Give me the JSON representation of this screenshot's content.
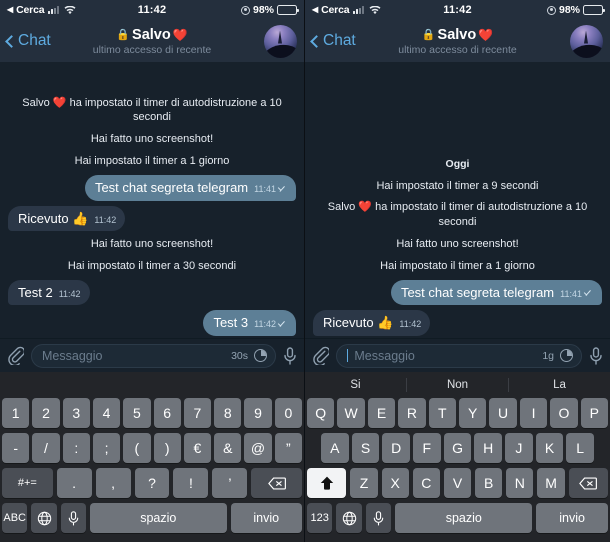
{
  "screens": [
    {
      "id": "left",
      "status_bar": {
        "back_arrow": "◀",
        "carrier_label": "Cerca",
        "time": "11:42",
        "battery_percent": "98%"
      },
      "header": {
        "back_label": "Chat",
        "lock_icon": "lock-icon",
        "title": "Salvo",
        "title_emoji": "❤️",
        "subtitle": "ultimo accesso di recente",
        "avatar": "contact-avatar"
      },
      "messages": [
        {
          "kind": "service",
          "text": "Salvo ❤️ ha impostato il timer di autodistruzione a 10 secondi"
        },
        {
          "kind": "service",
          "text": "Hai fatto uno screenshot!"
        },
        {
          "kind": "service",
          "text": "Hai impostato il timer a 1 giorno"
        },
        {
          "kind": "out",
          "text": "Test chat segreta telegram",
          "time": "11:41",
          "read": true
        },
        {
          "kind": "in",
          "text": "Ricevuto 👍",
          "time": "11:42",
          "read": false
        },
        {
          "kind": "service",
          "text": "Hai fatto uno screenshot!"
        },
        {
          "kind": "service",
          "text": "Hai impostato il timer a 30 secondi"
        },
        {
          "kind": "in",
          "text": "Test 2",
          "time": "11:42",
          "read": false
        },
        {
          "kind": "out",
          "text": "Test 3",
          "time": "11:42",
          "read": true
        }
      ],
      "input_bar": {
        "attach_icon": "paperclip-icon",
        "placeholder": "Messaggio",
        "show_caret": false,
        "timer_value": "30s",
        "timer_icon": "self-destruct-timer-icon",
        "mic_icon": "microphone-icon"
      },
      "keyboard": {
        "layout": "numeric-symbols",
        "predictions": [],
        "rows": [
          [
            "1",
            "2",
            "3",
            "4",
            "5",
            "6",
            "7",
            "8",
            "9",
            "0"
          ],
          [
            "-",
            "/",
            ":",
            ";",
            "(",
            ")",
            "€",
            "&",
            "@",
            "”"
          ],
          [
            "#+=",
            ".",
            ",",
            "?",
            "!",
            "’",
            "backspace-icon"
          ],
          [
            "ABC",
            "globe-icon",
            "microphone-icon",
            "spazio",
            "invio"
          ]
        ],
        "shift_active": false
      }
    },
    {
      "id": "right",
      "status_bar": {
        "back_arrow": "◀",
        "carrier_label": "Cerca",
        "time": "11:42",
        "battery_percent": "98%"
      },
      "header": {
        "back_label": "Chat",
        "lock_icon": "lock-icon",
        "title": "Salvo",
        "title_emoji": "❤️",
        "subtitle": "ultimo accesso di recente",
        "avatar": "contact-avatar"
      },
      "messages": [
        {
          "kind": "date",
          "text": "Oggi"
        },
        {
          "kind": "service",
          "text": "Hai impostato il timer a 9 secondi"
        },
        {
          "kind": "service",
          "text": "Salvo ❤️ ha impostato il timer di autodistruzione a 10 secondi"
        },
        {
          "kind": "service",
          "text": "Hai fatto uno screenshot!"
        },
        {
          "kind": "service",
          "text": "Hai impostato il timer a 1 giorno"
        },
        {
          "kind": "out",
          "text": "Test chat segreta telegram",
          "time": "11:41",
          "read": true
        },
        {
          "kind": "in",
          "text": "Ricevuto 👍",
          "time": "11:42",
          "read": false
        }
      ],
      "input_bar": {
        "attach_icon": "paperclip-icon",
        "placeholder": "Messaggio",
        "show_caret": true,
        "timer_value": "1g",
        "timer_icon": "self-destruct-timer-icon",
        "mic_icon": "microphone-icon"
      },
      "keyboard": {
        "layout": "qwerty-uppercase",
        "predictions": [
          "Si",
          "Non",
          "La"
        ],
        "rows": [
          [
            "Q",
            "W",
            "E",
            "R",
            "T",
            "Y",
            "U",
            "I",
            "O",
            "P"
          ],
          [
            "A",
            "S",
            "D",
            "F",
            "G",
            "H",
            "J",
            "K",
            "L"
          ],
          [
            "shift-icon",
            "Z",
            "X",
            "C",
            "V",
            "B",
            "N",
            "M",
            "backspace-icon"
          ],
          [
            "123",
            "globe-icon",
            "microphone-icon",
            "spazio",
            "invio"
          ]
        ],
        "shift_active": true
      }
    }
  ],
  "colors": {
    "app_background": "#17212b",
    "header_background": "#242f3d",
    "bubble_out": "#5d7f96",
    "bubble_in": "#2b3747",
    "accent_blue": "#5eabe0",
    "keyboard_background": "#232529",
    "key_background": "#6f747b",
    "key_dark": "#4a4e55",
    "key_active": "#f2f3f5"
  }
}
